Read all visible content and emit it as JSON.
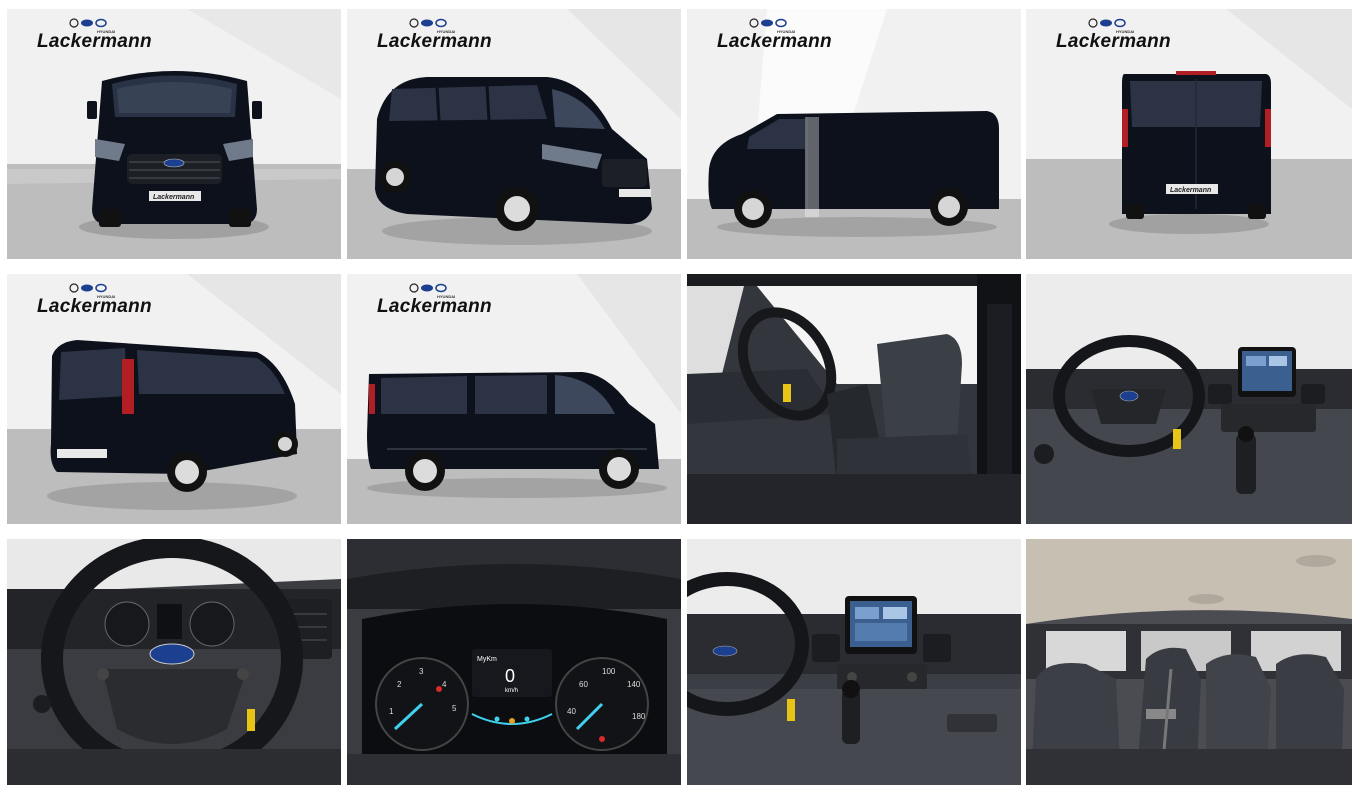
{
  "dealer": {
    "brand": "Lackermann",
    "sub_brand": "HYUNDAI",
    "plate_text": "Lackermann"
  },
  "cluster": {
    "display_label": "MyKm",
    "speed_value": "0",
    "speed_unit": "km/h"
  },
  "gallery": {
    "photos": [
      {
        "view": "front"
      },
      {
        "view": "front-three-quarter"
      },
      {
        "view": "side-left"
      },
      {
        "view": "rear"
      },
      {
        "view": "rear-three-quarter"
      },
      {
        "view": "side-right"
      },
      {
        "view": "driver-seat"
      },
      {
        "view": "dashboard"
      },
      {
        "view": "steering-wheel"
      },
      {
        "view": "instrument-cluster"
      },
      {
        "view": "center-console"
      },
      {
        "view": "rear-seats"
      }
    ]
  },
  "colors": {
    "van_paint": "#0d111c",
    "floor": "#bcbcbc",
    "wall": "#f1f1f1",
    "interior": "#2d2f33"
  }
}
